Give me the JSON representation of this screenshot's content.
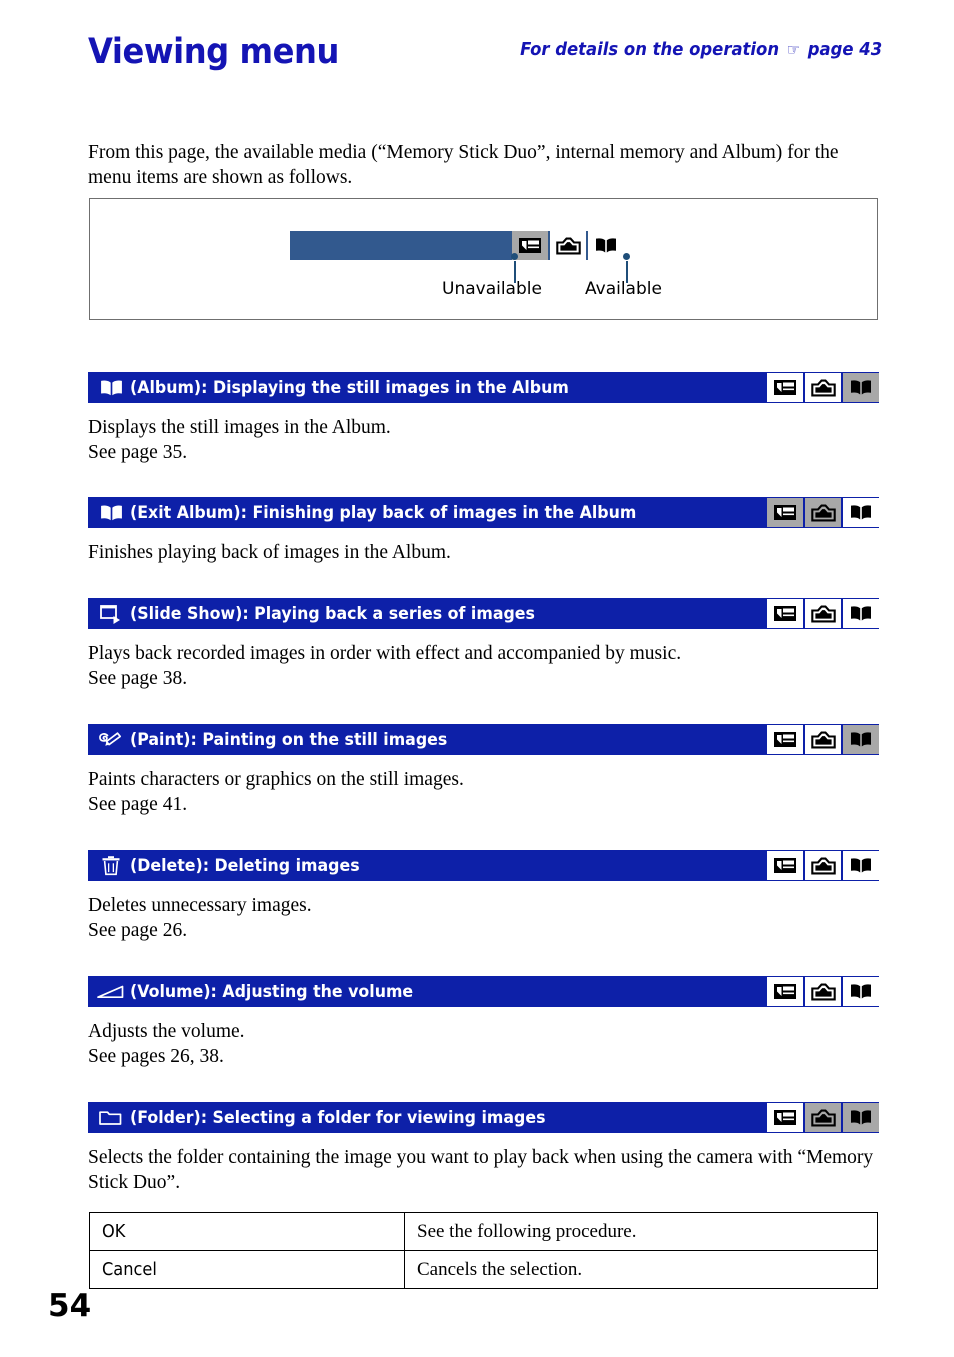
{
  "header": {
    "title": "Viewing menu",
    "note_before": "For details on the operation",
    "note_hand_icon": "pointing-hand-icon",
    "note_after": "page 43",
    "accent_color": "#1414b4"
  },
  "intro": {
    "text": "From this page, the available media (“Memory Stick Duo”, internal memory and Album) for the menu items are shown as follows."
  },
  "legend": {
    "bar_color": "#32598e",
    "unavailable_label": "Unavailable",
    "available_label": "Available",
    "unavailable_color": "#a8a8a8",
    "available_color": "#ffffff",
    "icons": [
      {
        "name": "memory-stick-duo-icon",
        "state": "unavailable"
      },
      {
        "name": "internal-memory-icon",
        "state": "available"
      },
      {
        "name": "album-book-icon",
        "state": "available"
      }
    ]
  },
  "sections": [
    {
      "icon": "album-book-icon",
      "title": "(Album): Displaying the still images in the Album",
      "body": "Displays the still images in the Album.\nSee page 35.",
      "media": [
        "available",
        "available",
        "unavailable"
      ]
    },
    {
      "icon": "album-book-icon",
      "title": "(Exit Album): Finishing play back of images in the Album",
      "body": "Finishes playing back of images in the Album.",
      "media": [
        "unavailable",
        "unavailable",
        "available"
      ]
    },
    {
      "icon": "slide-show-icon",
      "title": "(Slide Show): Playing back a series of images",
      "body": "Plays back recorded images in order with effect and accompanied by music.\nSee page 38.",
      "media": [
        "available",
        "available",
        "available"
      ]
    },
    {
      "icon": "paint-pen-icon",
      "title": "(Paint): Painting on the still images",
      "body": "Paints characters or graphics on the still images.\nSee page 41.",
      "media": [
        "available",
        "available",
        "unavailable"
      ]
    },
    {
      "icon": "trash-delete-icon",
      "title": "(Delete): Deleting images",
      "body": "Deletes unnecessary images.\nSee page 26.",
      "media": [
        "available",
        "available",
        "available"
      ]
    },
    {
      "icon": "volume-wedge-icon",
      "title": "(Volume): Adjusting the volume",
      "body": "Adjusts the volume.\nSee pages 26, 38.",
      "media": [
        "available",
        "available",
        "available"
      ]
    },
    {
      "icon": "folder-icon",
      "title": "(Folder): Selecting a folder for viewing images",
      "body": "Selects the folder containing the image you want to play back when using the camera with “Memory Stick Duo”.",
      "media": [
        "available",
        "unavailable",
        "unavailable"
      ]
    }
  ],
  "option_table": {
    "rows": [
      {
        "key": "OK",
        "value": "See the following procedure."
      },
      {
        "key": "Cancel",
        "value": "Cancels the selection."
      }
    ]
  },
  "page_number": "54"
}
